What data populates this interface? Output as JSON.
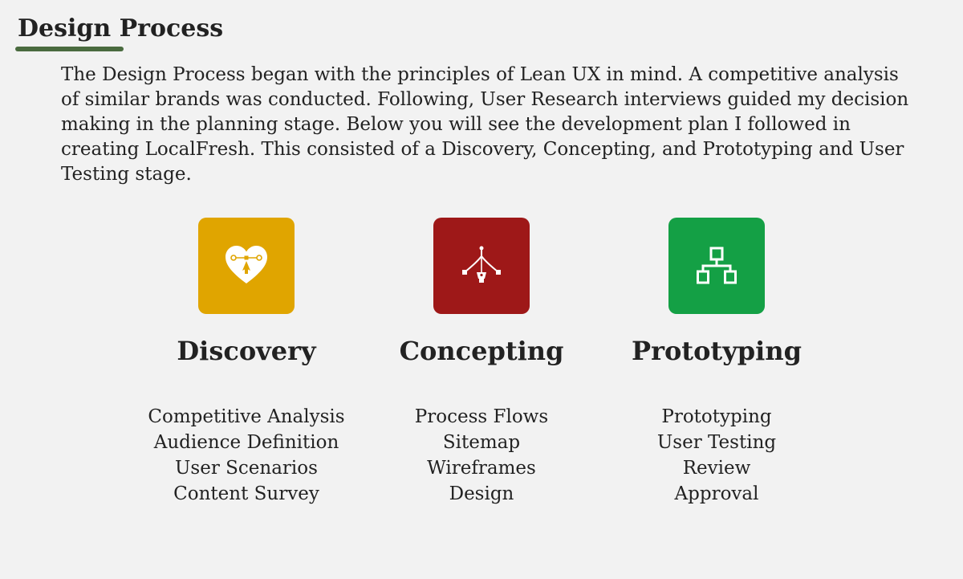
{
  "header": {
    "title": "Design Process"
  },
  "intro": {
    "text": "The Design Process began with the principles of Lean UX in mind. A competitive analysis of similar brands was conducted. Following, User Research interviews guided my decision making in the planning stage. Below you will see the development plan I followed in creating LocalFresh. This consisted of a Discovery, Concepting, and Prototyping and User Testing stage."
  },
  "stages": [
    {
      "icon": "heart-pen-tool-icon",
      "color": "#e0a500",
      "title": "Discovery",
      "items": [
        "Competitive Analysis",
        "Audience Definition",
        "User Scenarios",
        "Content Survey"
      ]
    },
    {
      "icon": "vector-pen-icon",
      "color": "#9e1818",
      "title": "Concepting",
      "items": [
        "Process Flows",
        "Sitemap",
        "Wireframes",
        "Design"
      ]
    },
    {
      "icon": "sitemap-icon",
      "color": "#14a045",
      "title": "Prototyping",
      "items": [
        "Prototyping",
        "User Testing",
        "Review",
        "Approval"
      ]
    }
  ],
  "colors": {
    "background": "#f2f2f2",
    "text": "#222222",
    "underline": "#4a6b3f"
  }
}
